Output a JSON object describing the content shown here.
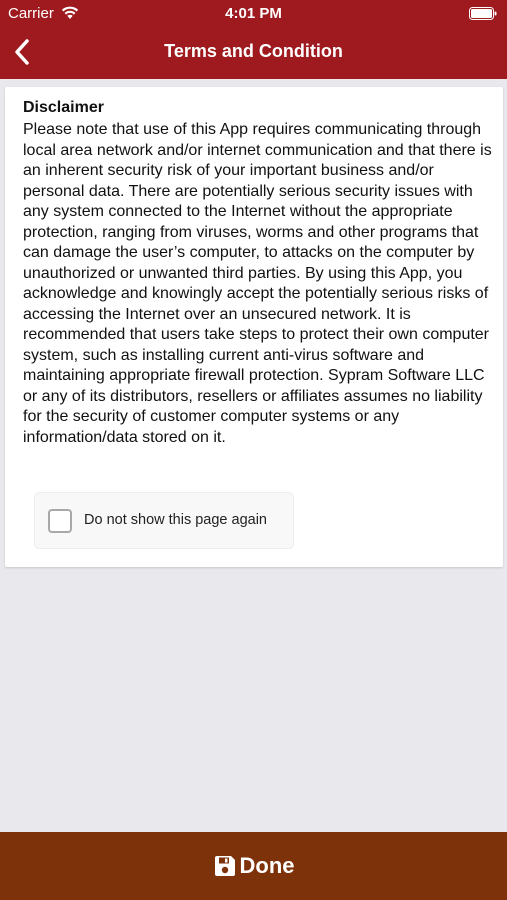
{
  "colors": {
    "header_bg": "#9e1a1f",
    "footer_bg": "#7e320a",
    "page_bg": "#e9e8ed"
  },
  "status_bar": {
    "carrier": "Carrier",
    "time": "4:01 PM",
    "icons": [
      "wifi-icon",
      "battery-icon"
    ]
  },
  "nav": {
    "back_icon": "chevron-left-icon",
    "title": "Terms and Condition"
  },
  "disclaimer": {
    "title": "Disclaimer",
    "body": "Please note that use of this App requires communicating through local area network and/or internet communication and that there is an inherent security risk of your important business and/or personal data. There are potentially serious security issues with any system connected to the Internet without the appropriate protection, ranging from viruses, worms and other programs that can damage the user’s computer, to attacks on the computer by unauthorized or unwanted third parties. By using this App, you acknowledge and knowingly accept the potentially serious risks of accessing the Internet over an unsecured network. It is recommended that users take steps to protect their own computer system, such as installing current anti-virus software and maintaining appropriate firewall protection. Sypram Software LLC or any of its distributors, resellers or affiliates assumes no liability for the security of customer computer systems or any information/data stored on it."
  },
  "checkbox": {
    "label": "Do not show this page again",
    "checked": false
  },
  "footer": {
    "icon": "save-icon",
    "done_label": "Done"
  }
}
